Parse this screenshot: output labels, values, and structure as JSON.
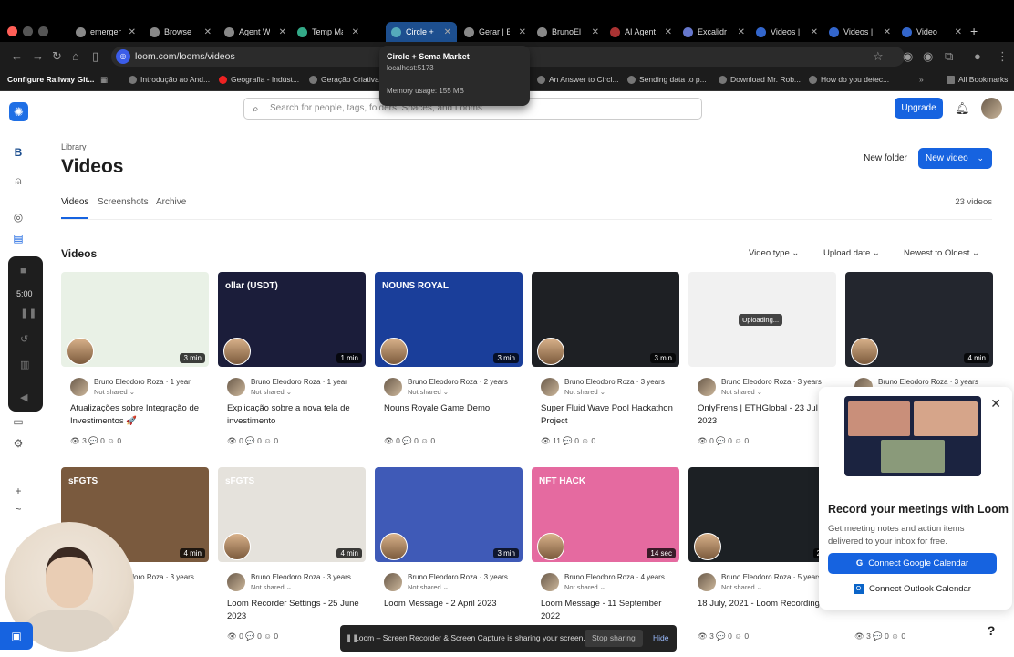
{
  "browser": {
    "tabs": [
      {
        "label": "emergen",
        "fav": "#888"
      },
      {
        "label": "Browse",
        "fav": "#888"
      },
      {
        "label": "Agent W",
        "fav": "#888"
      },
      {
        "label": "Temp Ma",
        "fav": "#3a8"
      },
      {
        "label": "Circle +",
        "fav": "#5ab"
      },
      {
        "label": "Gerar | E",
        "fav": "#888"
      },
      {
        "label": "BrunoEl",
        "fav": "#888"
      },
      {
        "label": "AI Agent",
        "fav": "#a33"
      },
      {
        "label": "Excalidr",
        "fav": "#67c"
      },
      {
        "label": "Videos |",
        "fav": "#36c"
      },
      {
        "label": "Videos |",
        "fav": "#36c"
      },
      {
        "label": "Video",
        "fav": "#36c"
      }
    ],
    "url": "loom.com/looms/videos",
    "bookmarks": [
      "Configure Railway Git...",
      "Introdução ao And...",
      "Geografia - Indúst...",
      "Geração Criativa",
      "An Answer to Circl...",
      "Sending data to p...",
      "Download Mr. Rob...",
      "How do you detec...",
      "All Bookmarks"
    ],
    "tooltip": {
      "title": "Circle + Sema Market",
      "url": "localhost:5173",
      "memory": "Memory usage: 155 MB"
    }
  },
  "header": {
    "search_placeholder": "Search for people, tags, folders, Spaces, and Looms",
    "upgrade": "Upgrade"
  },
  "sidebar": {
    "workspace_letter": "B",
    "timer": "5:00"
  },
  "page": {
    "library_label": "Library",
    "title": "Videos",
    "new_folder": "New folder",
    "new_video": "New video",
    "tabs": [
      "Videos",
      "Screenshots",
      "Archive"
    ],
    "count": "23 videos",
    "section_title": "Videos",
    "filters": [
      "Video type",
      "Upload date",
      "Newest to Oldest"
    ]
  },
  "cards": [
    {
      "author": "Bruno Eleodoro Roza · 1 year",
      "share": "Not shared",
      "title": "Atualizações sobre Integração de Investimentos 🚀",
      "duration": "3 min",
      "stats": "👁 3   💬 0   ☺ 0",
      "thumb": "#e9f1e6"
    },
    {
      "author": "Bruno Eleodoro Roza · 1 year",
      "share": "Not shared",
      "title": "Explicação sobre a nova tela de investimento",
      "duration": "1 min",
      "stats": "👁 0   💬 0   ☺ 0",
      "thumb": "#1b1d3a",
      "thumb_text": "ollar (USDT)"
    },
    {
      "author": "Bruno Eleodoro Roza · 2 years",
      "share": "Not shared",
      "title": "Nouns Royale Game Demo",
      "duration": "3 min",
      "stats": "👁 0   💬 0   ☺ 0",
      "thumb": "#1a3e9a",
      "thumb_text": "NOUNS ROYAL"
    },
    {
      "author": "Bruno Eleodoro Roza · 3 years",
      "share": "Not shared",
      "title": "Super Fluid Wave Pool Hackathon Project",
      "duration": "3 min",
      "stats": "👁 11   💬 0   ☺ 0",
      "thumb": "#1e2024"
    },
    {
      "author": "Bruno Eleodoro Roza · 3 years",
      "share": "Not shared",
      "title": "OnlyFrens | ETHGlobal - 23 Jul 2023",
      "duration": "",
      "stats": "👁 0   💬 0   ☺ 0",
      "thumb": "#f1f1f1",
      "uploading": "Uploading..."
    },
    {
      "author": "Bruno Eleodoro Roza · 3 years",
      "share": "Not shared",
      "title": "",
      "duration": "4 min",
      "stats": "",
      "thumb": "#23262e"
    },
    {
      "author": "Bruno Eleodoro Roza · 3 years",
      "share": "Not shared",
      "title": "- 25 June 2023",
      "duration": "4 min",
      "stats": "0",
      "thumb": "#7a5a3e",
      "thumb_text": "sFGTS"
    },
    {
      "author": "Bruno Eleodoro Roza · 3 years",
      "share": "Not shared",
      "title": "Loom Recorder Settings - 25 June 2023",
      "duration": "4 min",
      "stats": "👁 0   💬 0   ☺ 0",
      "thumb": "#e5e2dc",
      "thumb_text": "sFGTS"
    },
    {
      "author": "Bruno Eleodoro Roza · 3 years",
      "share": "Not shared",
      "title": "Loom Message - 2 April 2023",
      "duration": "3 min",
      "stats": "👁 0   💬 0   ☺ 0",
      "thumb": "#3f5ab7"
    },
    {
      "author": "Bruno Eleodoro Roza · 4 years",
      "share": "Not shared",
      "title": "Loom Message - 11 September 2022",
      "duration": "14 sec",
      "stats": "👁 0   💬 0   ☺ 0",
      "thumb": "#e56aa0",
      "thumb_text": "NFT HACK"
    },
    {
      "author": "Bruno Eleodoro Roza · 5 years",
      "share": "Not shared",
      "title": "18 July, 2021 - Loom Recording",
      "duration": "2 m",
      "stats": "👁 3   💬 0   ☺ 0",
      "thumb": "#1c2024"
    },
    {
      "author": "",
      "share": "",
      "title": "",
      "duration": "",
      "stats": "👁 3   💬 0   ☺ 0",
      "thumb": "#ffffff"
    }
  ],
  "popup": {
    "title": "Record your meetings with Loom",
    "desc": "Get meeting notes and action items delivered to your inbox for free.",
    "google": "Connect Google Calendar",
    "outlook": "Connect Outlook Calendar"
  },
  "sharebar": {
    "message": "Loom – Screen Recorder & Screen Capture is sharing your screen.",
    "stop": "Stop sharing",
    "hide": "Hide"
  },
  "help": "?"
}
